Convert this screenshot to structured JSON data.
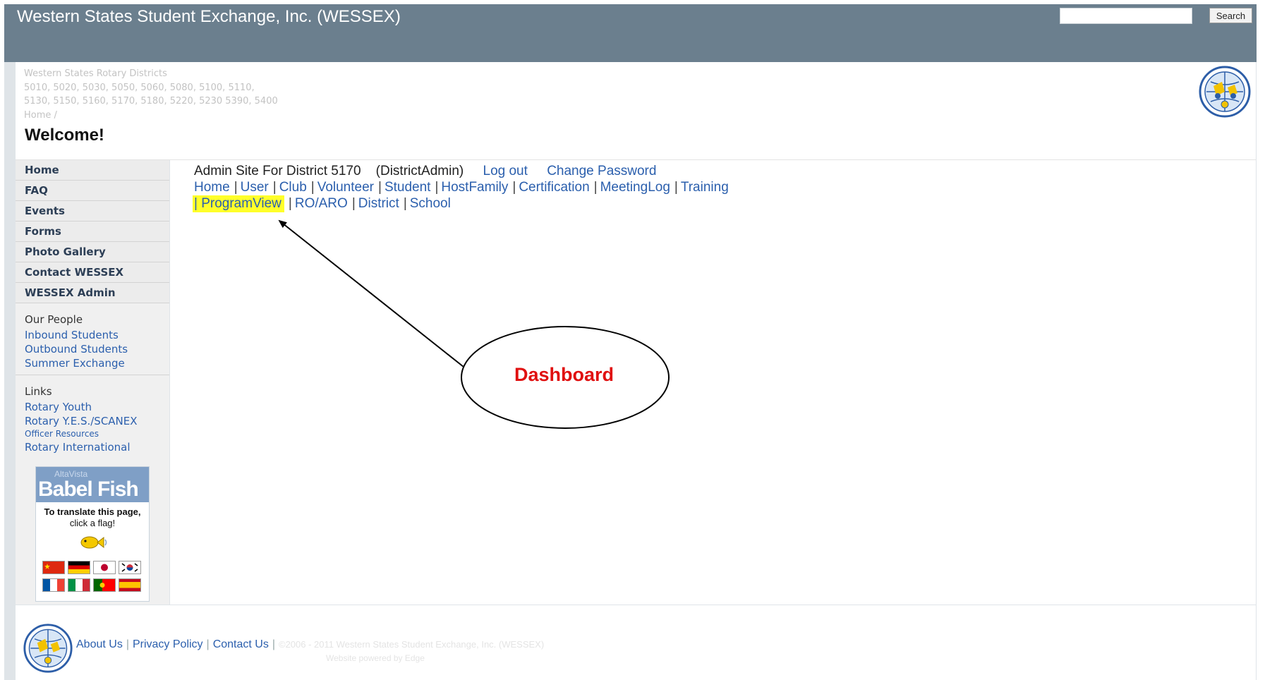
{
  "topbar": {
    "title": "Western States Student Exchange, Inc. (WESSEX)",
    "search_value": "",
    "search_button": "Search"
  },
  "header": {
    "district_lines": [
      "Western States Rotary Districts",
      "5010, 5020, 5030, 5050, 5060, 5080, 5100, 5110,",
      "5130, 5150, 5160, 5170, 5180, 5220, 5230 5390, 5400",
      "Home /"
    ],
    "welcome": "Welcome!",
    "logo_icon": "rotary-youth-exchange-logo-icon"
  },
  "sidebar": {
    "nav": [
      "Home",
      "FAQ",
      "Events",
      "Forms",
      "Photo Gallery",
      "Contact WESSEX",
      "WESSEX Admin"
    ],
    "people_heading": "Our People",
    "people_links": [
      "Inbound Students",
      "Outbound Students",
      "Summer Exchange"
    ],
    "links_heading": "Links",
    "links": [
      "Rotary Youth",
      "Rotary Y.E.S./SCANEX",
      "Officer Resources",
      "Rotary International"
    ]
  },
  "babel": {
    "subtitle": "AltaVista",
    "title": "Babel Fish",
    "text_line1": "To translate this page,",
    "text_line2": "click a flag!",
    "fish_icon": "babel-fish-icon",
    "flags": [
      "china-flag",
      "germany-flag",
      "japan-flag",
      "korea-flag",
      "france-flag",
      "italy-flag",
      "portugal-flag",
      "spain-flag"
    ]
  },
  "main": {
    "admin_text": "Admin Site For District 5170",
    "role": "(DistrictAdmin)",
    "logout": "Log out",
    "change_password": "Change Password",
    "row1": [
      "Home",
      "User",
      "Club",
      "Volunteer",
      "Student",
      "HostFamily",
      "Certification",
      "MeetingLog",
      "Training"
    ],
    "row2_highlighted": "| ProgramView",
    "row2": [
      "RO/ARO",
      "District",
      "School"
    ],
    "separator": "|"
  },
  "annotation": {
    "label": "Dashboard",
    "label_color": "#e01010"
  },
  "footer": {
    "links": [
      "About Us",
      "Privacy Policy",
      "Contact Us"
    ],
    "separator": "|",
    "copyright": "©2006 - 2011 Western States Student Exchange, Inc. (WESSEX)",
    "copyright2": "Website powered by Edge"
  },
  "colors": {
    "topbar": "#6b7f8e",
    "link": "#2b5fad",
    "highlight": "#ffff2a",
    "nav_text": "#2d3f56"
  }
}
